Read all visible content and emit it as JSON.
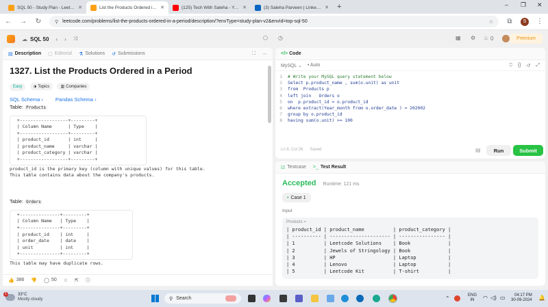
{
  "browser": {
    "tabs": [
      {
        "label": "SQL 50 - Study Plan - LeetCode",
        "fav": "#ffa116"
      },
      {
        "label": "List the Products Ordered in a P",
        "fav": "#ffa116"
      },
      {
        "label": "(125) Tech With Saleha - YouTube",
        "fav": "#ff0000"
      },
      {
        "label": "(3) Saleha Parveen | LinkedIn",
        "fav": "#0a66c2"
      }
    ],
    "url": "leetcode.com/problems/list-the-products-ordered-in-a-period/description/?envType=study-plan-v2&envId=top-sql-50",
    "profile_initial": "S"
  },
  "lc_header": {
    "study_plan": "SQL 50",
    "streak": "0",
    "premium": "Premium"
  },
  "left": {
    "tabs": {
      "description": "Description",
      "editorial": "Editorial",
      "solutions": "Solutions",
      "submissions": "Submissions"
    },
    "title": "1327. List the Products Ordered in a Period",
    "tags": {
      "difficulty": "Easy",
      "topics": "Topics",
      "companies": "Companies"
    },
    "links": {
      "sql_schema": "SQL Schema",
      "pandas_schema": "Pandas Schema"
    },
    "table_word": "Table:",
    "table1_name": "Products",
    "table1": " +------------------+---------+\n | Column Name      | Type    |\n +------------------+---------+\n | product_id       | int     |\n | product_name     | varchar |\n | product_category | varchar |\n +------------------+---------+",
    "table1_desc": "product_id is the primary key (column with unique values) for this table.\nThis table contains data about the company's products.",
    "table2_name": "Orders",
    "table2": " +---------------+---------+\n | Column Name   | Type    |\n +---------------+---------+\n | product_id    | int     |\n | order_date    | date    |\n | unit          | int     |\n +---------------+---------+",
    "table2_desc": "This table may have duplicate rows.",
    "likes": "386",
    "comments": "50"
  },
  "code": {
    "header": "Code",
    "language": "MySQL",
    "auto": "Auto",
    "lines": [
      "# Write your MySQL query statement below",
      "Select p.product_name , sum(o.unit) as unit",
      "from  Products p",
      "left join   Orders o",
      "on  p.product_id = o.product_id",
      "where extract(Year_month from o.order_date ) = 202002",
      "group by o.product_id",
      "having sum(o.unit) >= 100"
    ],
    "status": "Ln 8, Col 26",
    "saved": "Saved",
    "run": "Run",
    "submit": "Submit"
  },
  "result": {
    "tab_testcase": "Testcase",
    "tab_result": "Test Result",
    "verdict": "Accepted",
    "runtime": "Runtime: 121 ms",
    "case": "Case 1",
    "input_label": "Input",
    "products_label": "Products =",
    "grid": "| product_id | product_name          | product_category |\n| ---------- | --------------------- | ---------------- |\n| 1          | Leetcode Solutions    | Book             |\n| 2          | Jewels of Stringology | Book             |\n| 3          | HP                    | Laptop           |\n| 4          | Lenovo                | Laptop           |\n| 5          | Leetcode Kit          | T-shirt          |"
  },
  "taskbar": {
    "temp": "33°C",
    "weather": "Mostly cloudy",
    "search": "Search",
    "lang": "ENG",
    "region": "IN",
    "time": "04:17 PM",
    "date": "30-09-2024",
    "weather_badge": "1"
  },
  "colors": {
    "accent": "#ffa116",
    "run_bg": "#f0f0f0",
    "submit_bg": "#28c244",
    "accepted": "#2cbb5d"
  }
}
